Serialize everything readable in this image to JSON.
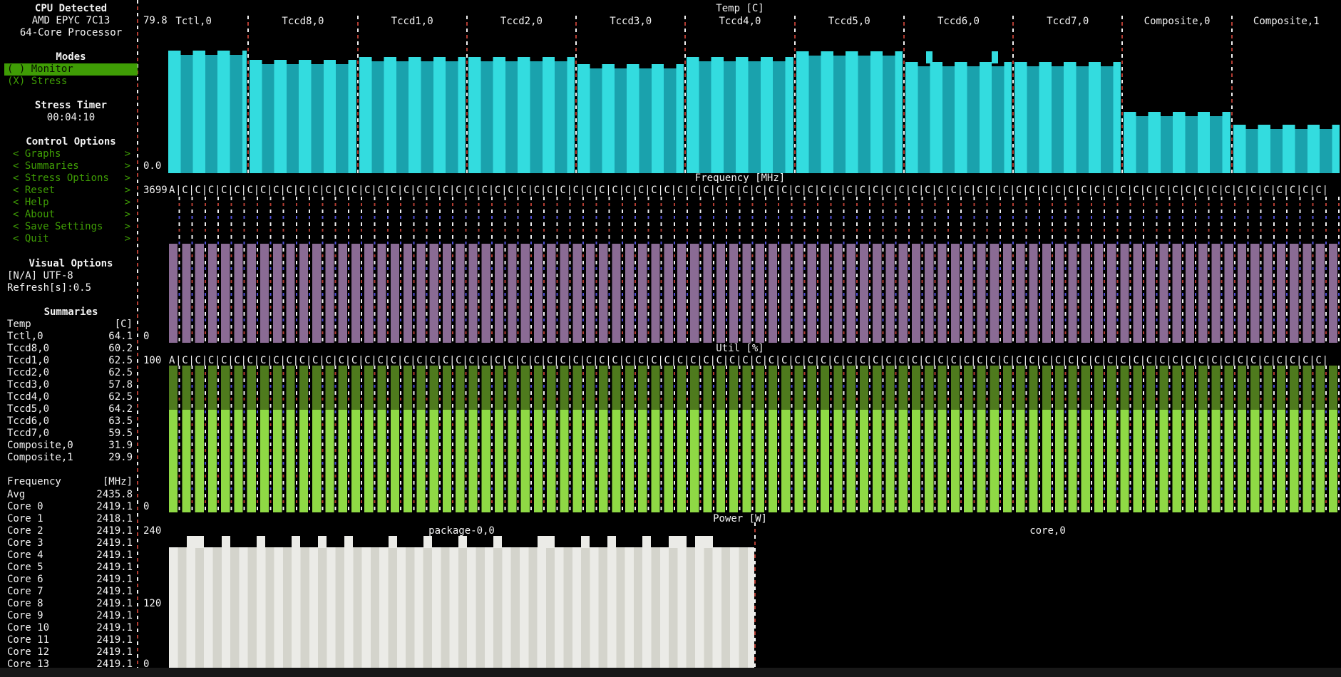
{
  "colors": {
    "bg": "#000000",
    "text": "#f2f2f2",
    "green_text": "#3f9d05",
    "highlight_bg": "#3f9d05",
    "cyan_bright": "#33dcdf",
    "cyan_dark": "#1aa2ad",
    "purple": "#8a6b94",
    "green_dark": "#4e7a1d",
    "green_bright": "#8fd945",
    "gray_bright": "#ebebe7",
    "gray_dark": "#d4d4cc",
    "dash_white": "#f2f2f2",
    "dash_red": "#b23c32",
    "dash_blue": "#5050d8",
    "bottom_strip": "#181818"
  },
  "sidebar": {
    "rows": [
      {
        "s": "h",
        "t": "CPU Detected"
      },
      {
        "s": "c",
        "t": "AMD EPYC 7C13"
      },
      {
        "s": "c",
        "t": "64-Core Processor"
      },
      {
        "s": "blank"
      },
      {
        "s": "h",
        "t": "Modes"
      },
      {
        "s": "hl",
        "t": "( ) Monitor"
      },
      {
        "s": "g",
        "t": "(X) Stress"
      },
      {
        "s": "blank"
      },
      {
        "s": "h",
        "t": "Stress Timer"
      },
      {
        "s": "c",
        "t": "00:04:10"
      },
      {
        "s": "blank"
      },
      {
        "s": "h",
        "t": "Control Options"
      },
      {
        "s": "menu",
        "t": "Graphs"
      },
      {
        "s": "menu",
        "t": "Summaries"
      },
      {
        "s": "menu",
        "t": "Stress Options"
      },
      {
        "s": "menu",
        "t": "Reset"
      },
      {
        "s": "menu",
        "t": "Help"
      },
      {
        "s": "menu",
        "t": "About"
      },
      {
        "s": "menu",
        "t": "Save Settings"
      },
      {
        "s": "menu",
        "t": "Quit"
      },
      {
        "s": "blank"
      },
      {
        "s": "h",
        "t": "Visual Options"
      },
      {
        "s": "l",
        "t": "[N/A] UTF-8"
      },
      {
        "s": "l",
        "t": "Refresh[s]:0.5"
      },
      {
        "s": "blank"
      },
      {
        "s": "h",
        "t": "Summaries"
      },
      {
        "s": "kv",
        "t": "Temp",
        "v": "[C]"
      },
      {
        "s": "kv",
        "t": "Tctl,0",
        "v": "64.1"
      },
      {
        "s": "kv",
        "t": "Tccd8,0",
        "v": "60.2"
      },
      {
        "s": "kv",
        "t": "Tccd1,0",
        "v": "62.5"
      },
      {
        "s": "kv",
        "t": "Tccd2,0",
        "v": "62.5"
      },
      {
        "s": "kv",
        "t": "Tccd3,0",
        "v": "57.8"
      },
      {
        "s": "kv",
        "t": "Tccd4,0",
        "v": "62.5"
      },
      {
        "s": "kv",
        "t": "Tccd5,0",
        "v": "64.2"
      },
      {
        "s": "kv",
        "t": "Tccd6,0",
        "v": "63.5"
      },
      {
        "s": "kv",
        "t": "Tccd7,0",
        "v": "59.5"
      },
      {
        "s": "kv",
        "t": "Composite,0",
        "v": "31.9"
      },
      {
        "s": "kv",
        "t": "Composite,1",
        "v": "29.9"
      },
      {
        "s": "blank"
      },
      {
        "s": "kv",
        "t": "Frequency",
        "v": "[MHz]"
      },
      {
        "s": "kv",
        "t": "Avg",
        "v": "2435.8"
      },
      {
        "s": "kv",
        "t": "Core 0",
        "v": "2419.1"
      },
      {
        "s": "kv",
        "t": "Core 1",
        "v": "2418.1"
      },
      {
        "s": "kv",
        "t": "Core 2",
        "v": "2419.1"
      },
      {
        "s": "kv",
        "t": "Core 3",
        "v": "2419.1"
      },
      {
        "s": "kv",
        "t": "Core 4",
        "v": "2419.1"
      },
      {
        "s": "kv",
        "t": "Core 5",
        "v": "2419.1"
      },
      {
        "s": "kv",
        "t": "Core 6",
        "v": "2419.1"
      },
      {
        "s": "kv",
        "t": "Core 7",
        "v": "2419.1"
      },
      {
        "s": "kv",
        "t": "Core 8",
        "v": "2419.1"
      },
      {
        "s": "kv",
        "t": "Core 9",
        "v": "2419.1"
      },
      {
        "s": "kv",
        "t": "Core 10",
        "v": "2419.1"
      },
      {
        "s": "kv",
        "t": "Core 11",
        "v": "2419.1"
      },
      {
        "s": "kv",
        "t": "Core 12",
        "v": "2419.1"
      },
      {
        "s": "kv",
        "t": "Core 13",
        "v": "2419.1"
      }
    ]
  },
  "graphs": {
    "temp": {
      "title": "Temp [C]",
      "y_max_label": "79.8",
      "y_min_label": "0.0",
      "scale_max": 79.8,
      "sections": [
        {
          "label": "Tctl,0",
          "value": 64.1,
          "bar": 64.3
        },
        {
          "label": "Tccd8,0",
          "value": 60.2,
          "bar": 59.4
        },
        {
          "label": "Tccd1,0",
          "value": 62.5,
          "bar": 60.9
        },
        {
          "label": "Tccd2,0",
          "value": 62.5,
          "bar": 60.9
        },
        {
          "label": "Tccd3,0",
          "value": 57.8,
          "bar": 57.2
        },
        {
          "label": "Tccd4,0",
          "value": 62.5,
          "bar": 60.9
        },
        {
          "label": "Tccd5,0",
          "value": 64.2,
          "bar": 63.9
        },
        {
          "label": "Tccd6,0",
          "value": 63.5,
          "bar": 58.3
        },
        {
          "label": "Tccd7,0",
          "value": 59.5,
          "bar": 58.3
        },
        {
          "label": "Composite,0",
          "value": 31.9,
          "bar": 32.2
        },
        {
          "label": "Composite,1",
          "value": 29.9,
          "bar": 25.4
        }
      ],
      "spikes": [
        {
          "section": 7,
          "frac": 0.2,
          "level": 64.5
        },
        {
          "section": 7,
          "frac": 0.8,
          "level": 64.5
        }
      ]
    },
    "freq": {
      "title": "Frequency [MHz]",
      "y_max_label": "3699",
      "y_min_label": "0",
      "scale_max": 3699,
      "bar_level": 2410,
      "avg": 2435.8,
      "header_first": "A",
      "header_cell": "C",
      "header_sep": "|",
      "header_cols": 88
    },
    "util": {
      "title": "Util [%]",
      "y_max_label": "100",
      "y_min_label": "0",
      "scale_max": 100,
      "level": 100,
      "bright_level": 70,
      "header_first": "A",
      "header_cell": "C",
      "header_sep": "|",
      "header_cols": 88
    },
    "power": {
      "title": "Power [W]",
      "y_max_label": "240",
      "y_mid_label": "120",
      "y_min_label": "0",
      "scale_max": 240,
      "sections": [
        {
          "label": "package-0,0",
          "watts": 211,
          "spike_watts": 232
        },
        {
          "label": "core,0",
          "watts": 0
        }
      ],
      "spike_offsets": [
        20,
        40,
        79,
        119,
        171,
        213,
        243,
        303,
        355,
        408,
        461,
        515,
        533,
        578,
        615,
        666,
        695,
        711,
        740,
        756
      ]
    }
  }
}
